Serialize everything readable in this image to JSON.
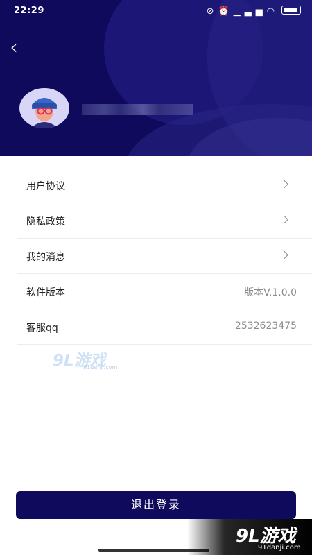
{
  "status_bar": {
    "time": "22:29",
    "icons": [
      "alarm-off-icon",
      "alarm-icon",
      "signal-icon",
      "signal-icon",
      "wifi-icon",
      "battery-icon"
    ]
  },
  "header": {
    "back_icon": "chevron-left-icon",
    "background_color": "#0f0a5c"
  },
  "menu": {
    "items": [
      {
        "label": "用户协议",
        "value": "",
        "icon": "chevron-right-icon"
      },
      {
        "label": "隐私政策",
        "value": "",
        "icon": "chevron-right-icon"
      },
      {
        "label": "我的消息",
        "value": "",
        "icon": "chevron-right-icon"
      },
      {
        "label": "软件版本",
        "value": "版本V.1.0.0"
      },
      {
        "label": "客服qq",
        "value": "2532623475"
      }
    ]
  },
  "watermark": {
    "brand": "9L游戏",
    "domain": "91danji.com"
  },
  "logout": {
    "label": "退出登录",
    "color": "#0f0a5c"
  }
}
